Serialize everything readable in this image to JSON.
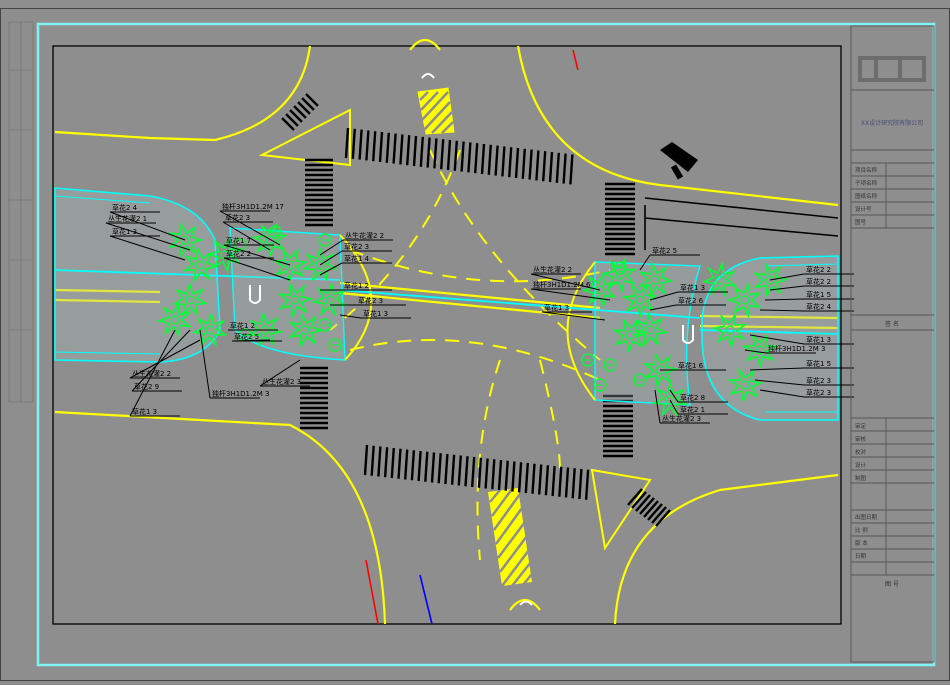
{
  "plan": {
    "colors": {
      "background": "#8e8e8e",
      "frame": "#7ff3f3",
      "road_line": "#ffff00",
      "median": "#00ffff",
      "planting": "#00ff33",
      "white_line": "#ffffff",
      "crosswalk": "#000000"
    },
    "plant_labels": [
      {
        "text": "草花2 4"
      },
      {
        "text": "丛生花灌2 1"
      },
      {
        "text": "草花1 3"
      },
      {
        "text": "独杆3H1D1.2M 17"
      },
      {
        "text": "草花2 3"
      },
      {
        "text": "草花1 7"
      },
      {
        "text": "草花2 2"
      },
      {
        "text": "丛生花灌2 2"
      },
      {
        "text": "草花2 3"
      },
      {
        "text": "草花1 4"
      },
      {
        "text": "草花1 2"
      },
      {
        "text": "草花2 3"
      },
      {
        "text": "草花1 3"
      },
      {
        "text": "草花1 2"
      },
      {
        "text": "草花2 5"
      },
      {
        "text": "丛生花灌2 2"
      },
      {
        "text": "草花2 9"
      },
      {
        "text": "独杆3H1D1.2M 3"
      },
      {
        "text": "草花1 3"
      },
      {
        "text": "丛生花灌2 3"
      },
      {
        "text": "草花2 5"
      },
      {
        "text": "丛生花灌2 2"
      },
      {
        "text": "独杆3H1D1.2M 6"
      },
      {
        "text": "草花1 3"
      },
      {
        "text": "草花1 3"
      },
      {
        "text": "草花2 6"
      },
      {
        "text": "草花1 6"
      },
      {
        "text": "草花2 8"
      },
      {
        "text": "草花2 1"
      },
      {
        "text": "丛生花灌2 3"
      },
      {
        "text": "草花2 2"
      },
      {
        "text": "草花2 2"
      },
      {
        "text": "草花1 5"
      },
      {
        "text": "草花2 4"
      },
      {
        "text": "草花1 3"
      },
      {
        "text": "独杆3H1D1.2M 3"
      },
      {
        "text": "草花1 5"
      },
      {
        "text": "草花2 3"
      },
      {
        "text": "草花2 3"
      }
    ],
    "title_block": {
      "company_name": "XX设计研究院有限公司",
      "rows": [
        {
          "label": "项目名称",
          "value": ""
        },
        {
          "label": "子项名称",
          "value": ""
        },
        {
          "label": "图纸名称",
          "value": ""
        },
        {
          "label": "设计号",
          "value": ""
        },
        {
          "label": "图号",
          "value": ""
        }
      ],
      "label_mid": "签 名",
      "sign_rows": [
        {
          "label": "审定",
          "value": "",
          "signature": ""
        },
        {
          "label": "审核",
          "value": "",
          "signature": ""
        },
        {
          "label": "校对",
          "value": "",
          "signature": ""
        },
        {
          "label": "设计",
          "value": "",
          "signature": ""
        },
        {
          "label": "制图",
          "value": "",
          "signature": ""
        }
      ],
      "bottom_rows": [
        {
          "label": "出图日期"
        },
        {
          "label": "比 例"
        },
        {
          "label": "版 本"
        },
        {
          "label": "日期"
        }
      ],
      "label_bottom": "图 号"
    }
  }
}
